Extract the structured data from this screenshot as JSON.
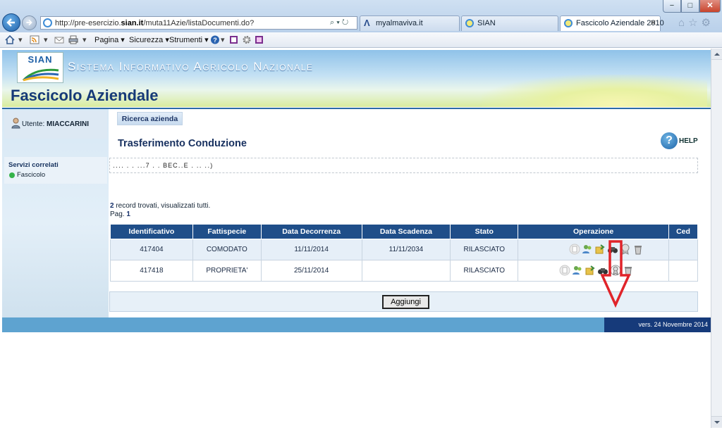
{
  "window": {
    "minimize": "−",
    "maximize": "□",
    "close": "✕"
  },
  "browser": {
    "url_prefix": "http://pre-esercizio.",
    "url_domain": "sian.it",
    "url_path": "/muta11Azie/listaDocumenti.do?",
    "address_tools": "⌕ ▾ ↻",
    "tabs": [
      {
        "label": "myalmaviva.it"
      },
      {
        "label": "SIAN"
      },
      {
        "label": "Fascicolo Aziendale 2010",
        "close": "✕",
        "active": true
      }
    ],
    "command_bar": {
      "pagina": "Pagina ▾",
      "sicurezza": "Sicurezza ▾",
      "strumenti": "Strumenti ▾",
      "help_glyph": "▾"
    }
  },
  "header": {
    "logo_text": "SIAN",
    "banner": "Sistema Informativo Agricolo Nazionale",
    "title": "Fascicolo Aziendale"
  },
  "sidebar": {
    "user_label": "Utente:",
    "user_name": "MIACCARINI",
    "services_title": "Servizi correlati",
    "services_items": [
      {
        "label": "Fascicolo"
      }
    ]
  },
  "main": {
    "tab_label": "Ricerca azienda",
    "section_title": "Trasferimento Conduzione",
    "help_label": "HELP",
    "help_glyph": "?",
    "info_text": "․․․․ ․ ․ ․․․7 ․ ․ BEC․․E ․ ․․ ․․)",
    "record_count_number": "2",
    "record_count_text": " record trovati, visualizzati tutti.",
    "page_label": "Pag. ",
    "page_number": "1",
    "add_button": "Aggiungi"
  },
  "table": {
    "columns": [
      "Identificativo",
      "Fattispecie",
      "Data Decorrenza",
      "Data Scadenza",
      "Stato",
      "Operazione",
      "Ced"
    ],
    "rows": [
      {
        "id": "417404",
        "fattispecie": "COMODATO",
        "decorrenza": "11/11/2014",
        "scadenza": "11/11/2034",
        "stato": "RILASCIATO",
        "ced": ""
      },
      {
        "id": "417418",
        "fattispecie": "PROPRIETA'",
        "decorrenza": "25/11/2014",
        "scadenza": "",
        "stato": "RILASCIATO",
        "ced": ""
      }
    ]
  },
  "footer": {
    "version": "vers. 24 Novembre 2014"
  },
  "colors": {
    "header_blue": "#1f4e89",
    "footer_band": "#5ea3d0",
    "footer_version_bg": "#163a7a",
    "annotation_red": "#e0242a"
  }
}
